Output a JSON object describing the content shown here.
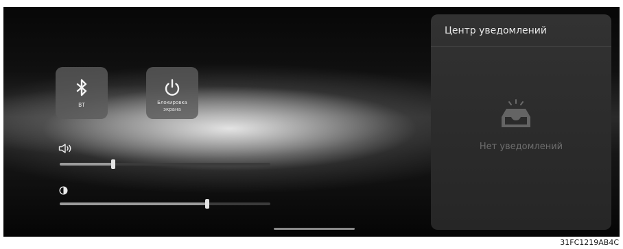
{
  "quick_tiles": [
    {
      "label": "BT",
      "icon": "bluetooth-icon"
    },
    {
      "label": "Блокировка экрана",
      "icon": "power-icon"
    }
  ],
  "sliders": {
    "volume": {
      "icon": "volume-icon",
      "value": 0.255
    },
    "brightness": {
      "icon": "brightness-icon",
      "value": 0.7
    }
  },
  "notification_center": {
    "title": "Центр уведомлений",
    "empty_icon": "empty-inbox-icon",
    "empty_text": "Нет уведомлений"
  },
  "footer": {
    "id_text": "31FC1219AB4C"
  },
  "colors": {
    "tile_bg": "#5c5c5c",
    "slider_track": "#3b3b3b",
    "slider_fill": "#9c9c9c",
    "slider_thumb": "#e4e4e4",
    "panel_bg": "#2c2c2c"
  }
}
